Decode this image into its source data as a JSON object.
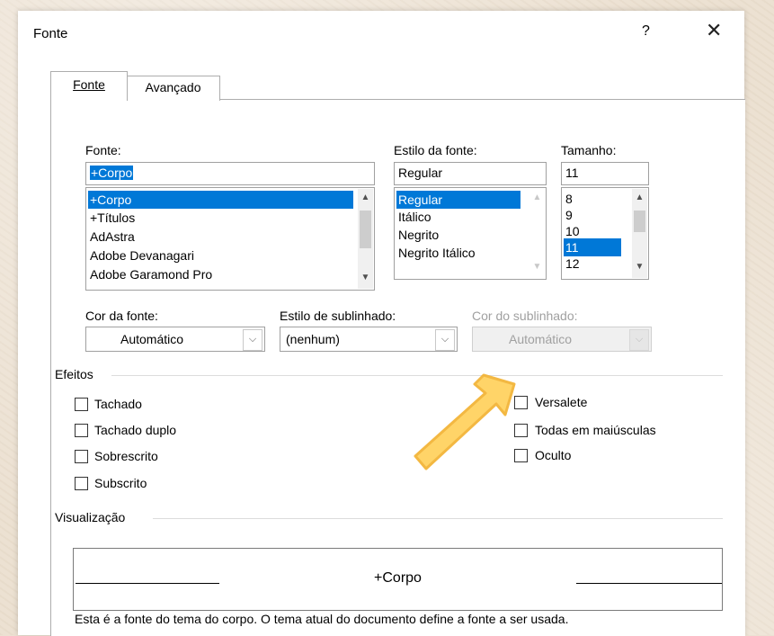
{
  "dialog": {
    "title": "Fonte",
    "help_label": "?",
    "close_label": "✕"
  },
  "tabs": [
    {
      "label": "Fonte",
      "selected": true
    },
    {
      "label": "Avançado",
      "selected": false
    }
  ],
  "font": {
    "label": "Fonte:",
    "value": "+Corpo",
    "list": [
      "+Corpo",
      "+Títulos",
      "AdAstra",
      "Adobe Devanagari",
      "Adobe Garamond Pro"
    ],
    "selected": "+Corpo"
  },
  "style": {
    "label": "Estilo da fonte:",
    "value": "Regular",
    "list": [
      "Regular",
      "Itálico",
      "Negrito",
      "Negrito Itálico"
    ],
    "selected": "Regular"
  },
  "size": {
    "label": "Tamanho:",
    "value": "11",
    "list": [
      "8",
      "9",
      "10",
      "11",
      "12"
    ],
    "selected": "11"
  },
  "font_color": {
    "label": "Cor da fonte:",
    "value": "Automático"
  },
  "underline_style": {
    "label": "Estilo de sublinhado:",
    "value": "(nenhum)"
  },
  "underline_color": {
    "label": "Cor do sublinhado:",
    "value": "Automático",
    "disabled": true
  },
  "effects": {
    "label": "Efeitos",
    "left": [
      {
        "label": "Tachado",
        "checked": false
      },
      {
        "label": "Tachado duplo",
        "checked": false
      },
      {
        "label": "Sobrescrito",
        "checked": false
      },
      {
        "label": "Subscrito",
        "checked": false
      }
    ],
    "right": [
      {
        "label": "Versalete",
        "checked": false
      },
      {
        "label": "Todas em maiúsculas",
        "checked": false
      },
      {
        "label": "Oculto",
        "checked": false
      }
    ]
  },
  "preview": {
    "label": "Visualização",
    "sample": "+Corpo",
    "description": "Esta é a fonte do tema do corpo. O tema atual do documento define a fonte a ser usada."
  },
  "colors": {
    "selection": "#0078d7",
    "arrow_fill": "#ffd15c",
    "arrow_stroke": "#f2b233"
  },
  "annotation": {
    "icon": "highlight-arrow-icon"
  }
}
